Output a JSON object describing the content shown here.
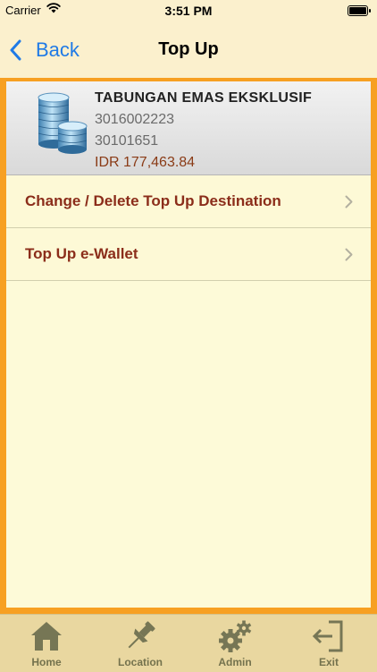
{
  "status_bar": {
    "carrier": "Carrier",
    "time": "3:51 PM"
  },
  "nav": {
    "back_label": "Back",
    "title": "Top Up"
  },
  "account": {
    "name": "TABUNGAN EMAS EKSKLUSIF",
    "number": "3016002223",
    "code": "30101651",
    "balance": "IDR 177,463.84"
  },
  "menu": [
    {
      "label": "Change / Delete Top Up Destination"
    },
    {
      "label": "Top Up e-Wallet"
    }
  ],
  "tabs": [
    {
      "label": "Home",
      "icon": "home-icon"
    },
    {
      "label": "Location",
      "icon": "pushpin-icon"
    },
    {
      "label": "Admin",
      "icon": "gears-icon"
    },
    {
      "label": "Exit",
      "icon": "exit-icon"
    }
  ],
  "colors": {
    "accent_orange": "#f7a022",
    "link_blue": "#1f7ae6",
    "menu_text": "#8b2d1a",
    "tabbar_bg": "#e9d7a0"
  }
}
